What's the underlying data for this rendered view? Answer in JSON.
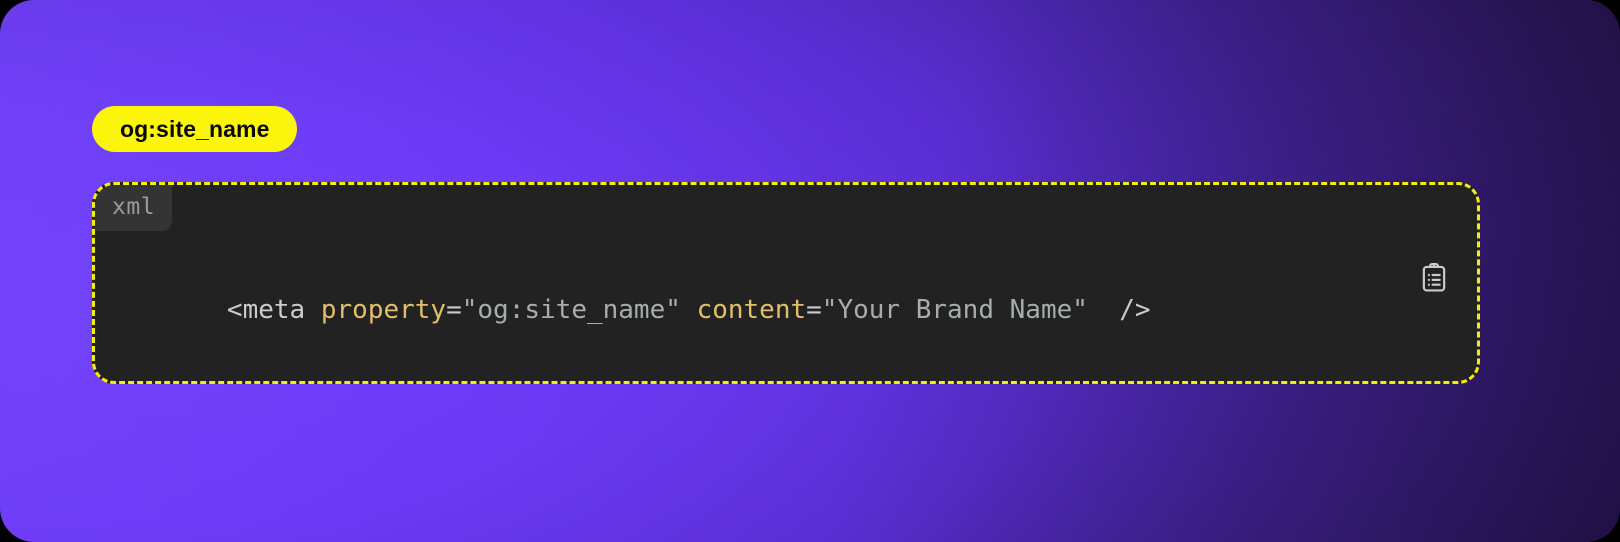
{
  "background": {
    "gradient_from": "#7040F8",
    "gradient_mid": "#5C2FD9",
    "gradient_to": "#231244"
  },
  "badge": {
    "label": "og:site_name",
    "background_color": "#FAF50A",
    "text_color": "#0A0A0A"
  },
  "code_block": {
    "language_label": "xml",
    "border_color": "#F5EE0B",
    "background_color": "#222222",
    "copy_icon": "clipboard-list-icon",
    "tokens": {
      "tag_open": "<meta",
      "space1": " ",
      "attr_property": "property",
      "eq1": "=",
      "value_property": "\"og:site_name\"",
      "space2": " ",
      "attr_content": "content",
      "eq2": "=",
      "value_content": "\"Your Brand Name\"",
      "space3": "  ",
      "tag_close": "/>"
    },
    "full_code": "<meta property=\"og:site_name\" content=\"Your Brand Name\" />",
    "colors": {
      "tag": "#C9CCCB",
      "attribute": "#E3BE6A",
      "string": "#A7ADAC",
      "language_tag_text": "#9B9B9B",
      "language_tag_bg": "#343434"
    }
  }
}
